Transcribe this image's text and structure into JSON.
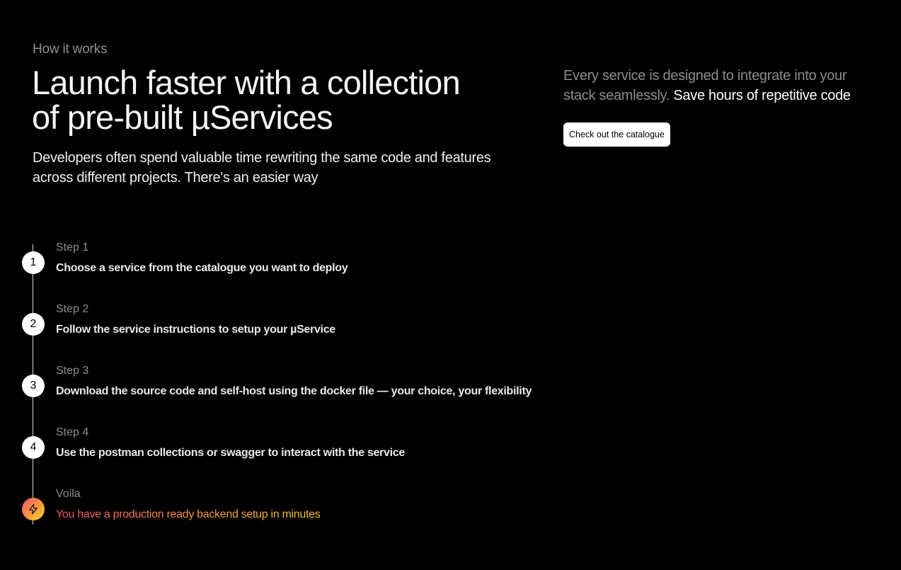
{
  "hero": {
    "eyebrow": "How it works",
    "headline_line1": "Launch faster with a collection",
    "headline_line2": "of pre-built µServices",
    "intro_line1": "Developers often spend valuable time rewriting the same code and features",
    "intro_line2": "across different projects. There's an easier way"
  },
  "aside": {
    "muted_line1": "Every service is designed to integrate into your",
    "muted_line2": "stack seamlessly.",
    "highlight": "Save hours of repetitive code",
    "cta_label": "Check out the catalogue"
  },
  "steps": [
    {
      "marker": "1",
      "label": "Step 1",
      "text": "Choose a service from the catalogue you want to deploy"
    },
    {
      "marker": "2",
      "label": "Step 2",
      "text": "Follow the service instructions to setup your µService"
    },
    {
      "marker": "3",
      "label": "Step 3",
      "text": "Download the source code and self-host using the docker file — your choice, your flexibility"
    },
    {
      "marker": "4",
      "label": "Step 4",
      "text": "Use the postman collections or swagger to interact with the service"
    },
    {
      "marker_icon": "lightning-bolt-icon",
      "label": "Voila",
      "text": "You have a production ready backend setup in minutes"
    }
  ],
  "colors": {
    "background": "#000000",
    "muted_text": "#8c8c8c",
    "accent_gradient_start": "#f0516b",
    "accent_gradient_end": "#fbd12c"
  }
}
